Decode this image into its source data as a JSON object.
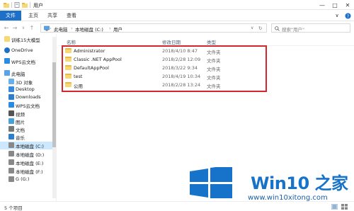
{
  "window": {
    "title": "用户",
    "controls": [
      "minimize",
      "maximize",
      "close"
    ]
  },
  "ribbon": {
    "file_tab": "文件",
    "tabs": [
      "主页",
      "共享",
      "查看"
    ]
  },
  "address": {
    "crumbs": [
      "此电脑",
      "本地磁盘 (C:)",
      "用户"
    ],
    "search_placeholder": "搜索\"用户\""
  },
  "nav": {
    "items": [
      {
        "label": "训练15大模型",
        "icon": "folder-icon"
      },
      {
        "label": "OneDrive",
        "icon": "cloud-icon"
      },
      {
        "label": "WPS云文档",
        "icon": "wps-cloud-icon"
      },
      {
        "label": "此电脑",
        "icon": "computer-icon"
      },
      {
        "label": "3D 对象",
        "icon": "cube-icon"
      },
      {
        "label": "Desktop",
        "icon": "desktop-icon"
      },
      {
        "label": "Downloads",
        "icon": "download-icon"
      },
      {
        "label": "WPS云文档",
        "icon": "wps-cloud-icon"
      },
      {
        "label": "视频",
        "icon": "video-icon"
      },
      {
        "label": "图片",
        "icon": "picture-icon"
      },
      {
        "label": "文档",
        "icon": "document-icon"
      },
      {
        "label": "音乐",
        "icon": "music-icon"
      },
      {
        "label": "本地磁盘 (C:)",
        "icon": "drive-icon"
      },
      {
        "label": "本地磁盘 (D:)",
        "icon": "drive-icon"
      },
      {
        "label": "本地磁盘 (E:)",
        "icon": "drive-icon"
      },
      {
        "label": "本地磁盘 (F:)",
        "icon": "drive-icon"
      },
      {
        "label": "G (G:)",
        "icon": "drive-icon"
      }
    ],
    "selected_index": 12
  },
  "columns": [
    "名称",
    "修改日期",
    "类型"
  ],
  "files": [
    {
      "name": "Administrator",
      "date": "2018/4/10 8:47",
      "type": "文件夹"
    },
    {
      "name": "Classic .NET AppPool",
      "date": "2018/2/28 12:09",
      "type": "文件夹"
    },
    {
      "name": "DefaultAppPool",
      "date": "2018/3/22 9:34",
      "type": "文件夹"
    },
    {
      "name": "test",
      "date": "2018/4/19 10:34",
      "type": "文件夹"
    },
    {
      "name": "公用",
      "date": "2018/2/28 13:24",
      "type": "文件夹"
    }
  ],
  "status": {
    "count": "5 个项目"
  },
  "watermark": {
    "brand": "Win10 之家",
    "url": "www.win10xitong.com",
    "colors": {
      "blue": "#1773c9"
    }
  },
  "colors": {
    "accent": "#1e6fc8",
    "selection": "#cce8ff",
    "highlight_box": "#d6262b",
    "folder": "#f8d775"
  }
}
